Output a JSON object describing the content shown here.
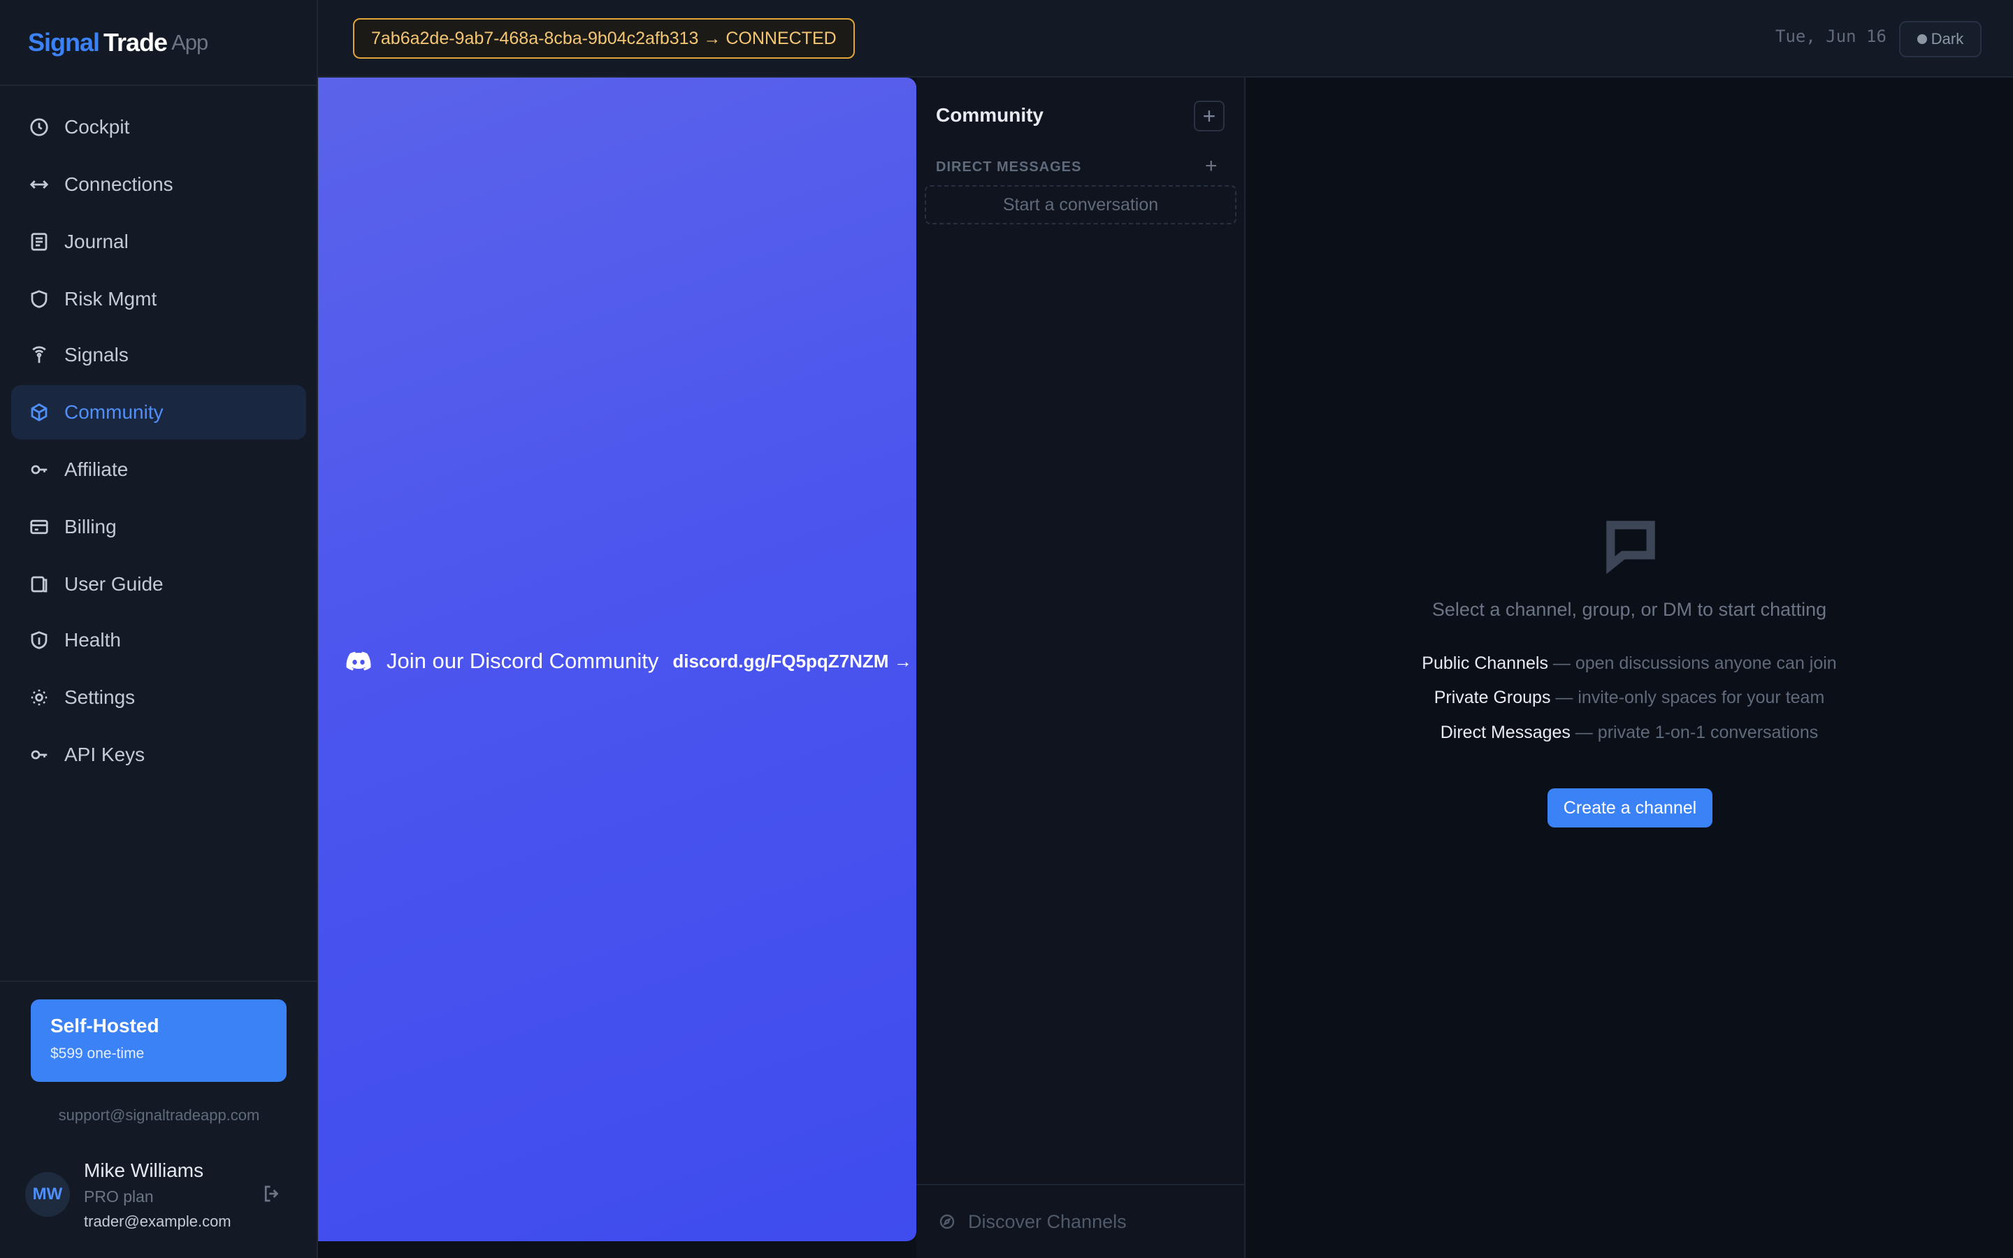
{
  "brand": {
    "part1": "Signal",
    "part2": "Trade",
    "part3": "App"
  },
  "topbar": {
    "connection": "7ab6a2de-9ab7-468a-8cba-9b04c2afb313 → CONNECTED",
    "date": "Tue, Jun 16",
    "theme": "Dark"
  },
  "sidebar": {
    "items": [
      {
        "label": "Cockpit",
        "icon": "clock-icon"
      },
      {
        "label": "Connections",
        "icon": "arrows-horizontal-icon"
      },
      {
        "label": "Journal",
        "icon": "journal-icon"
      },
      {
        "label": "Risk Mgmt",
        "icon": "shield-icon"
      },
      {
        "label": "Signals",
        "icon": "broadcast-icon"
      },
      {
        "label": "Community",
        "icon": "cube-icon",
        "active": true
      },
      {
        "label": "Affiliate",
        "icon": "key-icon"
      },
      {
        "label": "Billing",
        "icon": "credit-card-icon"
      },
      {
        "label": "User Guide",
        "icon": "book-icon"
      },
      {
        "label": "Health",
        "icon": "heart-shield-icon"
      },
      {
        "label": "Settings",
        "icon": "gear-icon"
      },
      {
        "label": "API Keys",
        "icon": "key-icon"
      }
    ],
    "promo": {
      "title": " Self-Hosted",
      "price": "$599 one-time"
    },
    "support": "support@signaltradeapp.com",
    "user": {
      "initials": "MW",
      "name": "Mike Williams",
      "plan": "PRO plan",
      "email": "trader@example.com"
    }
  },
  "discord": {
    "title": "Join our Discord Community",
    "link": "discord.gg/FQ5pqZ7NZM →"
  },
  "channels": {
    "title": "Community",
    "dm_label": "DIRECT MESSAGES",
    "start_conversation": "Start a conversation",
    "discover": "Discover Channels"
  },
  "main": {
    "empty_text": "Select a channel, group, or DM to start chatting",
    "features": [
      {
        "name": "Public Channels",
        "desc": " — open discussions anyone can join"
      },
      {
        "name": "Private Groups",
        "desc": " — invite-only spaces for your team"
      },
      {
        "name": "Direct Messages",
        "desc": " — private 1-on-1 conversations"
      }
    ],
    "create_button": "Create a channel"
  },
  "colors": {
    "accent": "#3b82f6",
    "connected_border": "#e2a53a",
    "discord": "#4a54ee"
  }
}
